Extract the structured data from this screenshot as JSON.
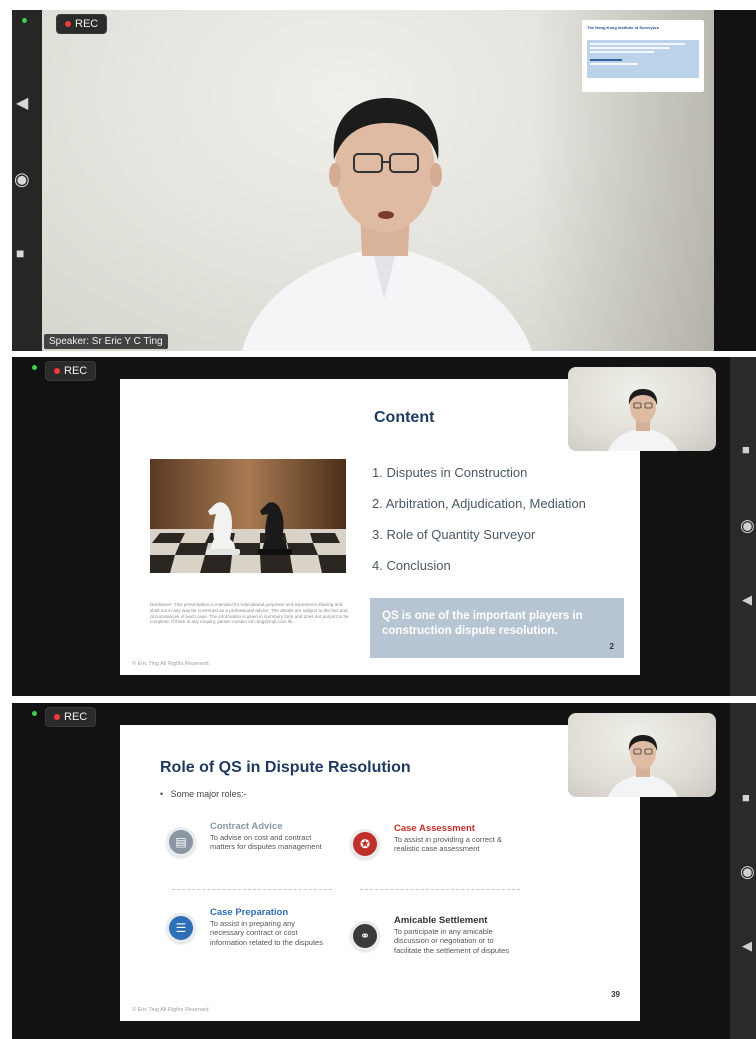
{
  "recording": {
    "label": "REC"
  },
  "top_view": {
    "speaker_label": "Speaker: Sr Eric Y C Ting",
    "thumbnail_slide": {
      "title": "The Hong Kong Institute of Surveyors"
    }
  },
  "slide_content": {
    "title": "Content",
    "items": [
      "1.  Disputes in Construction",
      "2.  Arbitration, Adjudication, Mediation",
      "3.  Role of Quantity Surveyor",
      "4.  Conclusion"
    ],
    "highlight": "QS is one of the important players in construction dispute resolution.",
    "disclaimer": "Disclaimer: This presentation is intended for educational purposes and experience sharing and shall not in any way be construed as a professional advice. The details are subject to the fact and circumstances of each case. The information is given in summary form and does not purport to be complete. If there is any enquiry, please contact eric.ting@mjd.com.hk.",
    "copyright": "© Eric Ting  All Rights Reserved.",
    "page_number": "2"
  },
  "slide_roles": {
    "title": "Role of QS in Dispute Resolution",
    "bullet": "Some major roles:-",
    "roles": [
      {
        "title": "Contract Advice",
        "desc": "To advise on cost and contract matters for disputes management",
        "color": "#8a96a3"
      },
      {
        "title": "Case Assessment",
        "desc": "To assist in providing a correct & realistic case assessment",
        "color": "#c0302b"
      },
      {
        "title": "Case Preparation",
        "desc": "To assist in preparing any necessary contract or cost information related to the disputes",
        "color": "#2f6fb5"
      },
      {
        "title": "Amicable Settlement",
        "desc": "To participate in any amicable discussion or negotiation or to facilitate the settlement of disputes",
        "color": "#333333"
      }
    ],
    "copyright": "© Eric Ting  All Rights Reserved.",
    "page_number": "39"
  }
}
